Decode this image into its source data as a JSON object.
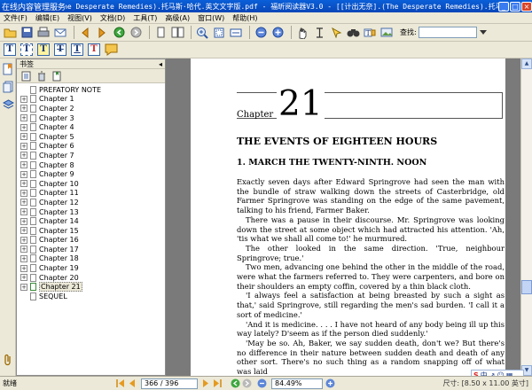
{
  "window": {
    "title": "[计出无奈].(The Desperate Remedies).托马斯·哈代.英文文字版.pdf - 福昕阅读器V3.0 - [[计出无奈].(The Desperate Remedies).托马",
    "tooltip": "在线内容管理服务"
  },
  "menu": {
    "items": [
      "文件(F)",
      "编辑(E)",
      "视图(V)",
      "文档(D)",
      "工具(T)",
      "高级(A)",
      "窗口(W)",
      "帮助(H)"
    ]
  },
  "toolbar": {
    "find_label": "查找:",
    "find_value": ""
  },
  "bookmarks": {
    "header": "书签",
    "items": [
      {
        "label": "PREFATORY NOTE",
        "expandable": false
      },
      {
        "label": "Chapter 1",
        "expandable": true
      },
      {
        "label": "Chapter 2",
        "expandable": true
      },
      {
        "label": "Chapter 3",
        "expandable": true
      },
      {
        "label": "Chapter 4",
        "expandable": true
      },
      {
        "label": "Chapter 5",
        "expandable": true
      },
      {
        "label": "Chapter 6",
        "expandable": true
      },
      {
        "label": "Chapter 7",
        "expandable": true
      },
      {
        "label": "Chapter 8",
        "expandable": true
      },
      {
        "label": "Chapter 9",
        "expandable": true
      },
      {
        "label": "Chapter 10",
        "expandable": true
      },
      {
        "label": "Chapter 11",
        "expandable": true
      },
      {
        "label": "Chapter 12",
        "expandable": true
      },
      {
        "label": "Chapter 13",
        "expandable": true
      },
      {
        "label": "Chapter 14",
        "expandable": true
      },
      {
        "label": "Chapter 15",
        "expandable": true
      },
      {
        "label": "Chapter 16",
        "expandable": true
      },
      {
        "label": "Chapter 17",
        "expandable": true
      },
      {
        "label": "Chapter 18",
        "expandable": true
      },
      {
        "label": "Chapter 19",
        "expandable": true
      },
      {
        "label": "Chapter 20",
        "expandable": true
      },
      {
        "label": "Chapter 21",
        "expandable": true,
        "selected": true
      },
      {
        "label": "SEQUEL",
        "expandable": false
      }
    ]
  },
  "document": {
    "chapter_word": "Chapter",
    "chapter_number": "21",
    "chapter_title": "THE EVENTS OF EIGHTEEN HOURS",
    "section_title": "1. MARCH THE TWENTY-NINTH. NOON",
    "paragraphs": [
      "Exactly seven days after Edward Springrove had seen the man with the bundle of straw walking down the streets of Casterbridge, old Farmer Springrove was standing on the edge of the same pavement, talking to his friend, Farmer Baker.",
      "There was a pause in their discourse. Mr. Springrove was looking down the street at some object which had attracted his attention. 'Ah, 'tis what we shall all come to!' he murmured.",
      "The other looked in the same direction. 'True, neighbour Springrove; true.'",
      "Two men, advancing one behind the other in the middle of the road, were what the farmers referred to. They were carpenters, and bore on their shoulders an empty coffin, covered by a thin black cloth.",
      "'I always feel a satisfaction at being breasted by such a sight as that,' said Springrove, still regarding the men's sad burden. 'I call it a sort of medicine.'",
      "'And it is medicine. . . . I have not heard of any body being ill up this way lately? D'seem as if the person died suddenly.'",
      "'May be so. Ah, Baker, we say sudden death, don't we? But there's no difference in their nature between sudden death and death of any other sort. There's no such thing as a random snapping off of what was laid"
    ]
  },
  "status": {
    "ready_text": "就绪",
    "page_value": "366 / 396",
    "zoom_value": "84.49%",
    "size_label": "尺寸: [8.50 x 11.00 英寸]"
  },
  "ime": {
    "label": "中"
  }
}
